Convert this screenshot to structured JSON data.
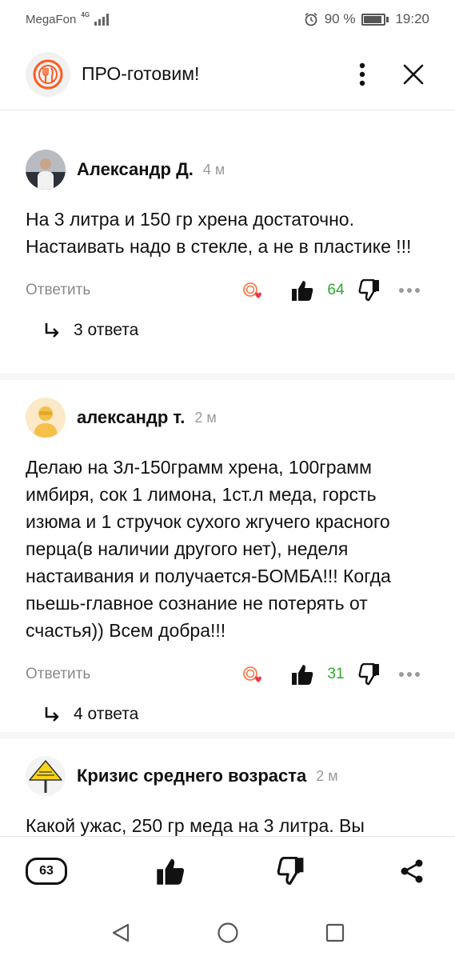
{
  "status_bar": {
    "carrier": "MegaFon",
    "network": "4G",
    "battery": "90 %",
    "time": "19:20"
  },
  "header": {
    "title": "ПРО-готовим!"
  },
  "comments": [
    {
      "author": "Александр Д.",
      "time": "4 м",
      "text": "На 3 литра и 150 гр хрена достаточно. Настаивать надо в стекле, а не в пластике !!!",
      "reply_label": "Ответить",
      "likes": "64",
      "replies": "3 ответа"
    },
    {
      "author": "александр т.",
      "time": "2 м",
      "text": "Делаю на 3л-150грамм хрена, 100грамм имбиря, сок 1 лимона, 1ст.л меда, горсть изюма и 1 стручок сухого жгучего красного перца(в наличии другого нет), неделя настаивания и получается-БОМБА!!! Когда пьешь-главное сознание не потерять от счастья)) Всем добра!!!",
      "reply_label": "Ответить",
      "likes": "31",
      "replies": "4 ответа"
    },
    {
      "author": "Кризис среднего возраста",
      "time": "2 м",
      "text": "Какой ужас, 250 гр меда на 3 литра. Вы"
    }
  ],
  "bottom_bar": {
    "comments_count": "63"
  },
  "colors": {
    "accent_orange": "#ff5a1f",
    "like_green": "#2eaa2e",
    "muted": "#8a8a8a",
    "avatar_yellow": "#f5c04a"
  },
  "icons": [
    "logo-icon",
    "menu-dots-icon",
    "close-icon",
    "reaction-icon",
    "like-icon",
    "dislike-icon",
    "more-icon",
    "reply-arrow-icon",
    "comments-icon",
    "share-icon",
    "back-icon",
    "home-icon",
    "recents-icon"
  ]
}
